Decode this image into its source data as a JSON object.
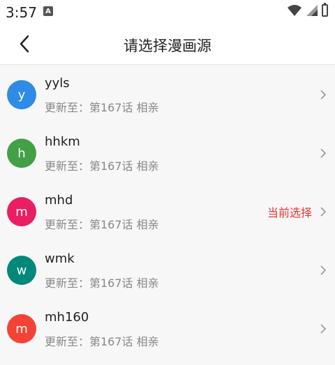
{
  "status_bar": {
    "time": "3:57",
    "notification_letter": "A"
  },
  "header": {
    "title": "请选择漫画源"
  },
  "sources": [
    {
      "letter": "y",
      "name": "yyls",
      "desc": "更新至：第167话 相亲",
      "color": "#2f8be6",
      "current": ""
    },
    {
      "letter": "h",
      "name": "hhkm",
      "desc": "更新至：第167话 相亲",
      "color": "#43a047",
      "current": ""
    },
    {
      "letter": "m",
      "name": "mhd",
      "desc": "更新至：第167话 相亲",
      "color": "#e91e63",
      "current": "当前选择"
    },
    {
      "letter": "w",
      "name": "wmk",
      "desc": "更新至：第167话 相亲",
      "color": "#00897b",
      "current": ""
    },
    {
      "letter": "m",
      "name": "mh160",
      "desc": "更新至：第167话 相亲",
      "color": "#f44336",
      "current": ""
    }
  ],
  "icons": {
    "back": "back-arrow-icon",
    "chevron": "chevron-right-icon"
  }
}
